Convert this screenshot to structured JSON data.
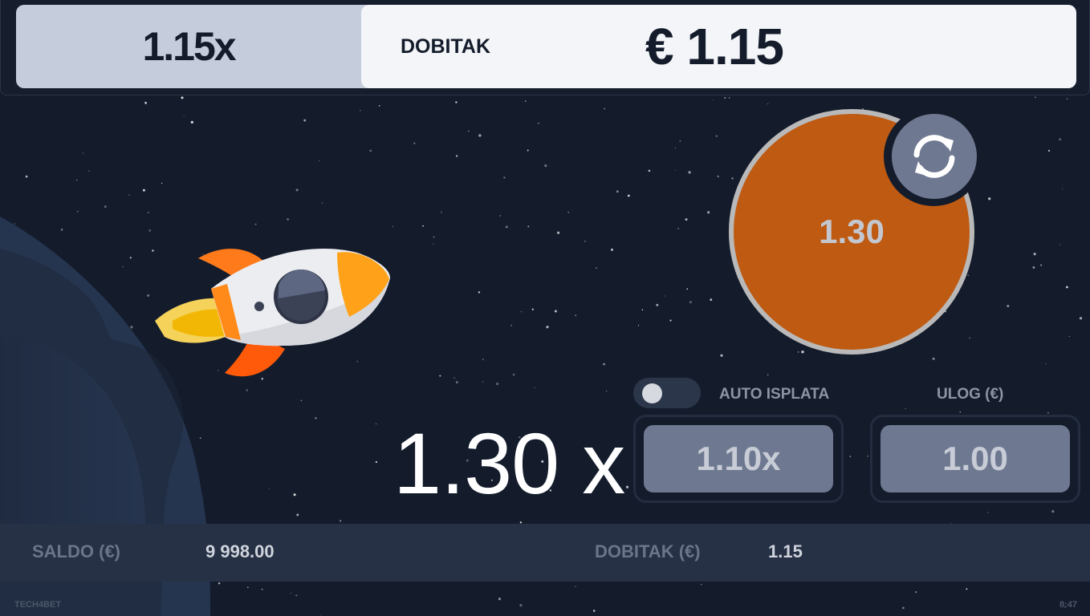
{
  "header": {
    "multiplier": "1.15x",
    "win_label": "DOBITAK",
    "win_value": "€ 1.15"
  },
  "game": {
    "play_button_value": "1.30",
    "refresh_icon": "refresh-icon",
    "current_multiplier": "1.30 x",
    "rocket_icon": "rocket-icon"
  },
  "controls": {
    "auto_cashout_label": "AUTO ISPLATA",
    "auto_cashout_enabled": false,
    "auto_cashout_value": "1.10x",
    "stake_label": "ULOG (€)",
    "stake_value": "1.00"
  },
  "footer": {
    "balance_label": "SALDO (€)",
    "balance_value": "9 998.00",
    "win_label": "DOBITAK (€)",
    "win_value": "1.15"
  },
  "meta": {
    "brand": "TECH4BET",
    "time": "8:47"
  },
  "colors": {
    "background": "#141c2c",
    "play_button": "#bf5a12",
    "field": "#6e7890",
    "header_multiplier_bg": "#c5ccdb"
  }
}
